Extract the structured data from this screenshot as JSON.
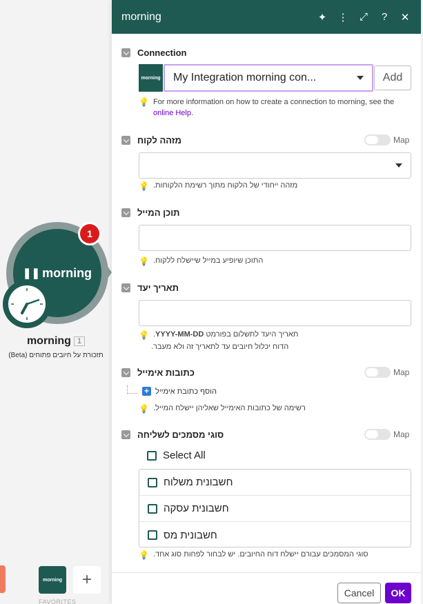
{
  "canvas": {
    "module_logo": "morning",
    "badge_count": "1",
    "module_name": "morning",
    "module_count": "1",
    "module_desc": "תזכורת על חיובים פתוחים (Beta)",
    "favorites_logo": "morning",
    "favorites_label": "FAVORITES"
  },
  "panel": {
    "title": "morning",
    "icons": [
      "sparkle-icon",
      "more-vertical-icon",
      "expand-icon",
      "help-icon",
      "close-icon"
    ],
    "icon_glyphs": [
      "✦",
      "⋮",
      "⤢",
      "?",
      "✕"
    ]
  },
  "connection": {
    "label": "Connection",
    "logo": "morning",
    "selected": "My Integration morning con...",
    "add_label": "Add",
    "hint_prefix": "For more information on how to create a connection to morning, see the ",
    "hint_link": "online Help",
    "hint_suffix": "."
  },
  "customer_id": {
    "label": "מזהה לקוח",
    "map_label": "Map",
    "value": "",
    "hint": "מזהה ייחודי של הלקוח מתוך רשימת הלקוחות."
  },
  "email_content": {
    "label": "תוכן המייל",
    "value": "",
    "hint": "התוכן שיופיע במייל שיישלח ללקוח."
  },
  "due_date": {
    "label": "תאריך יעד",
    "value": "",
    "hint_line1_a": "תאריך היעד לתשלום בפורמט ",
    "hint_line1_b": "YYYY-MM-DD",
    "hint_line1_c": ".",
    "hint_line2": "הדוח יכלול חיובים עד לתאריך זה ולא מעבר."
  },
  "emails": {
    "label": "כתובות אימייל",
    "map_label": "Map",
    "add_label": "הוסף כתובת אימייל",
    "hint": "רשימה של כתובות האימייל שאליהן יישלח המייל."
  },
  "doc_types": {
    "label": "סוגי מסמכים לשליחה",
    "map_label": "Map",
    "select_all": "Select All",
    "options": [
      "חשבונית משלוח",
      "חשבונית עסקה",
      "חשבונית מס"
    ],
    "hint": "סוגי המסמכים עבורם יישלח דוח החיובים. יש לבחור לפחות סוג אחד."
  },
  "footer": {
    "cancel": "Cancel",
    "ok": "OK"
  },
  "colors": {
    "brand": "#1e5a52",
    "accent": "#6d00cc",
    "badge": "#d91b1b"
  }
}
